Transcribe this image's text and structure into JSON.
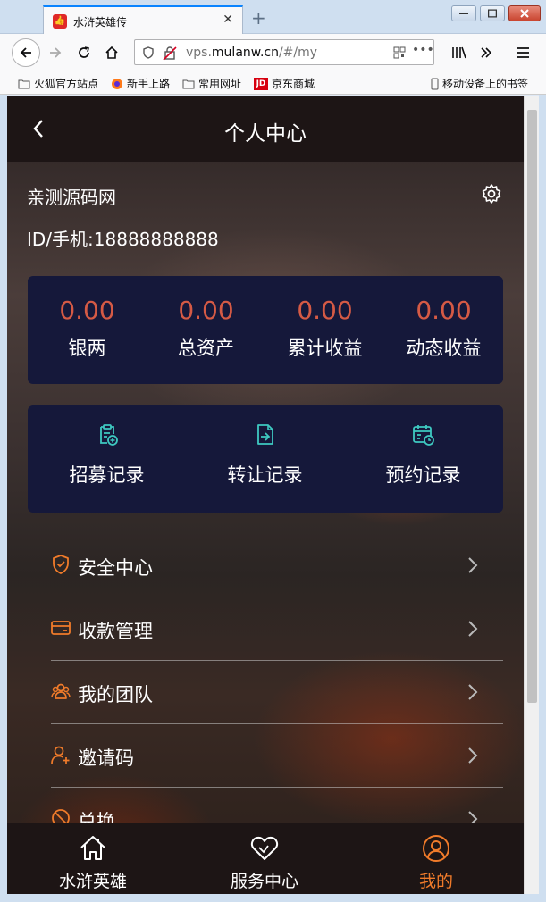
{
  "browser": {
    "tab_title": "水浒英雄传",
    "url_prefix": "vps.",
    "url_domain": "mulanw.cn",
    "url_path": "/#/my",
    "bookmarks": [
      "火狐官方站点",
      "新手上路",
      "常用网址",
      "京东商城"
    ],
    "mobile_bookmarks": "移动设备上的书签"
  },
  "header": {
    "title": "个人中心"
  },
  "user": {
    "name": "亲测源码网",
    "id_line": "ID/手机:18888888888"
  },
  "stats": [
    {
      "value": "0.00",
      "label": "银两"
    },
    {
      "value": "0.00",
      "label": "总资产"
    },
    {
      "value": "0.00",
      "label": "累计收益"
    },
    {
      "value": "0.00",
      "label": "动态收益"
    }
  ],
  "records": [
    {
      "label": "招募记录",
      "icon": "clipboard-plus-icon"
    },
    {
      "label": "转让记录",
      "icon": "transfer-doc-icon"
    },
    {
      "label": "预约记录",
      "icon": "calendar-clock-icon"
    }
  ],
  "menu": [
    {
      "label": "安全中心",
      "icon": "shield-icon"
    },
    {
      "label": "收款管理",
      "icon": "card-icon"
    },
    {
      "label": "我的团队",
      "icon": "team-icon"
    },
    {
      "label": "邀请码",
      "icon": "user-add-icon"
    },
    {
      "label": "兑换",
      "icon": "exchange-icon"
    }
  ],
  "tabbar": [
    {
      "label": "水浒英雄",
      "icon": "home-icon"
    },
    {
      "label": "服务中心",
      "icon": "heart-icon"
    },
    {
      "label": "我的",
      "icon": "user-icon",
      "active": true
    }
  ],
  "colors": {
    "accent": "#f07b2a",
    "stat_value": "#d55a45",
    "card_bg": "#15183a",
    "icon_teal": "#3ec9c1"
  }
}
